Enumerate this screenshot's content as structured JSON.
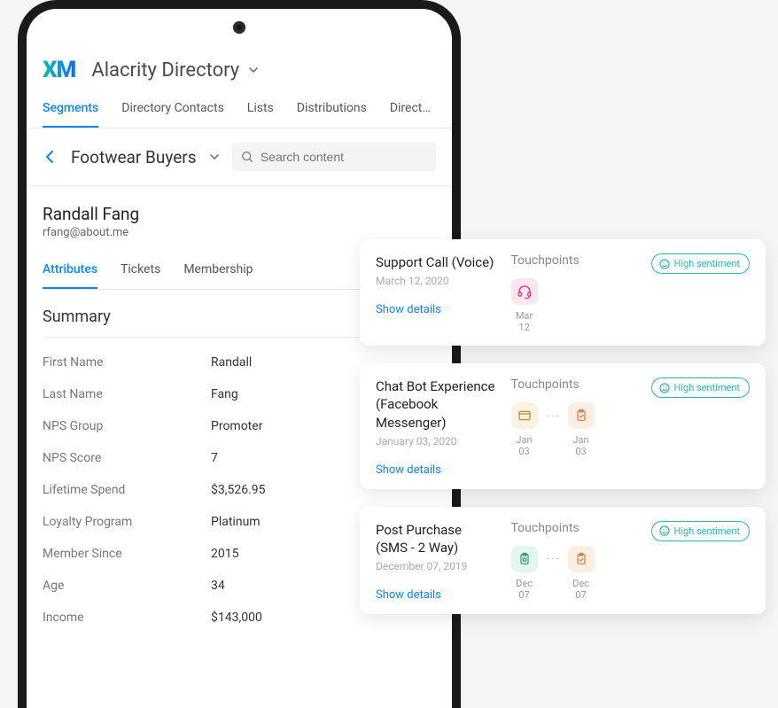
{
  "header": {
    "logo_text": "XM",
    "directory_label": "Alacrity Directory"
  },
  "tabs": [
    "Segments",
    "Directory Contacts",
    "Lists",
    "Distributions",
    "Direct…"
  ],
  "active_tab_index": 0,
  "segment": {
    "title": "Footwear Buyers",
    "search_placeholder": "Search content"
  },
  "contact": {
    "name": "Randall Fang",
    "email": "rfang@about.me"
  },
  "subtabs": [
    "Attributes",
    "Tickets",
    "Membership"
  ],
  "active_subtab_index": 0,
  "summary_heading": "Summary",
  "attributes": [
    {
      "label": "First Name",
      "value": "Randall"
    },
    {
      "label": "Last Name",
      "value": "Fang"
    },
    {
      "label": "NPS Group",
      "value": "Promoter"
    },
    {
      "label": "NPS Score",
      "value": "7"
    },
    {
      "label": "Lifetime Spend",
      "value": "$3,526.95"
    },
    {
      "label": "Loyalty Program",
      "value": "Platinum"
    },
    {
      "label": "Member Since",
      "value": "2015"
    },
    {
      "label": "Age",
      "value": "34"
    },
    {
      "label": "Income",
      "value": "$143,000"
    }
  ],
  "touchpoints_label": "Touchpoints",
  "show_details_label": "Show details",
  "sentiment_label": "High sentiment",
  "cards": [
    {
      "title": "Support Call (Voice)",
      "date": "March 12, 2020",
      "icons": [
        {
          "cls": "pink",
          "name": "headset-icon"
        }
      ],
      "icon_dates": [
        "Mar 12"
      ]
    },
    {
      "title": "Chat Bot Experience (Facebook Messenger)",
      "date": "January 03, 2020",
      "icons": [
        {
          "cls": "cream",
          "name": "browser-icon"
        },
        {
          "cls": "peach",
          "name": "clipboard-check-icon"
        }
      ],
      "icon_dates": [
        "Jan 03",
        "Jan 03"
      ]
    },
    {
      "title": "Post Purchase (SMS - 2 Way)",
      "date": "December 07, 2019",
      "icons": [
        {
          "cls": "mint",
          "name": "gear-clipboard-icon"
        },
        {
          "cls": "peach",
          "name": "clipboard-check-icon"
        }
      ],
      "icon_dates": [
        "Dec 07",
        "Dec 07"
      ]
    }
  ]
}
